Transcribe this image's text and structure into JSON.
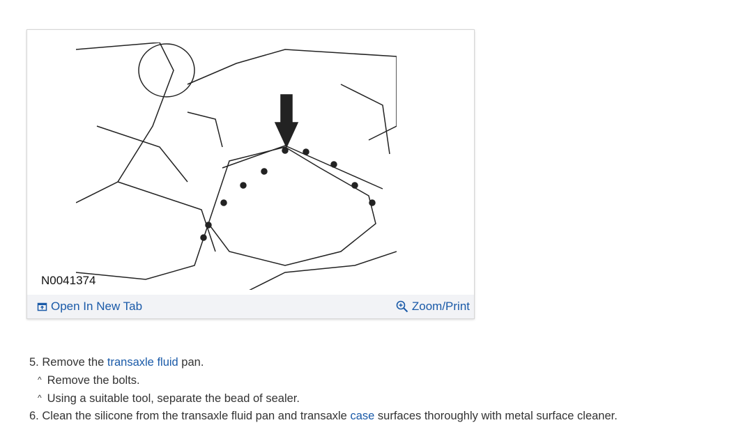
{
  "figure": {
    "caption": "N0041374",
    "open_label": "Open In New Tab",
    "zoom_label": "Zoom/Print"
  },
  "steps": [
    {
      "num": "5.",
      "pre": "Remove the ",
      "link": "transaxle fluid",
      "post": " pan."
    },
    {
      "bullet": "^",
      "text": "Remove the bolts."
    },
    {
      "bullet": "^",
      "text": "Using a suitable tool, separate the bead of sealer."
    },
    {
      "num": "6.",
      "pre": "Clean the silicone from the transaxle fluid pan and transaxle ",
      "link": "case",
      "post": " surfaces thoroughly with metal surface cleaner."
    }
  ],
  "colors": {
    "link": "#1a5aa8",
    "bar": "#f2f3f6"
  }
}
